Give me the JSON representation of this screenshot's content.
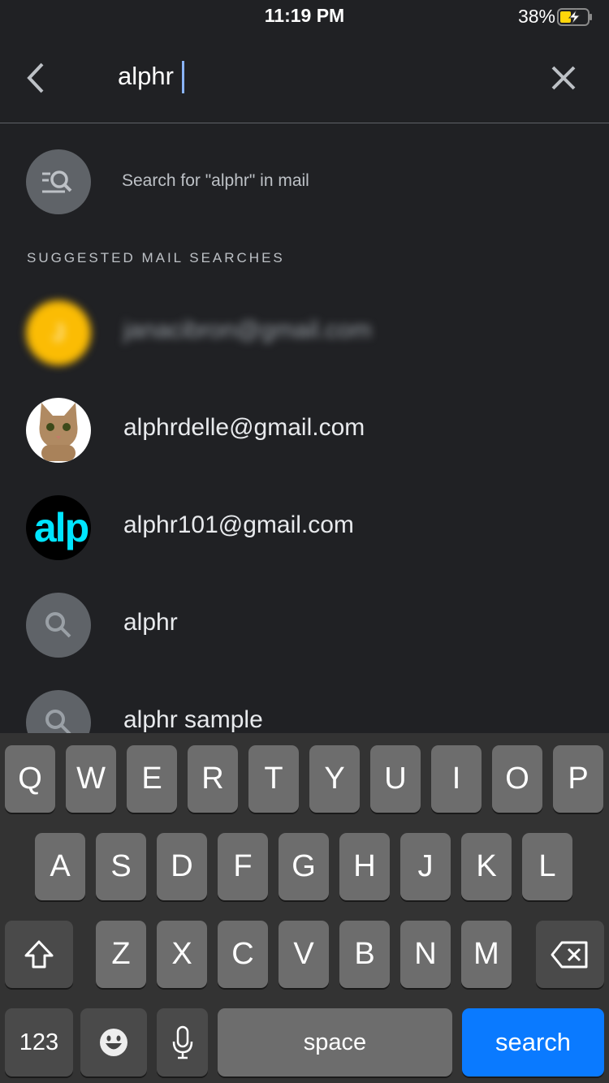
{
  "status_bar": {
    "time": "11:19 PM",
    "battery": "38%",
    "battery_level": 38,
    "charging": true
  },
  "search": {
    "query": "alphr",
    "hint": "Search for \"alphr\" in mail"
  },
  "suggestions": {
    "section_title": "SUGGESTED MAIL SEARCHES",
    "items": [
      {
        "type": "contact",
        "label": "janacibron@gmail.com",
        "avatar": "J",
        "avatar_color": "#fbbc04",
        "blurred": true
      },
      {
        "type": "contact",
        "label": "alphrdelle@gmail.com",
        "avatar": "cat-photo"
      },
      {
        "type": "contact",
        "label": "alphr101@gmail.com",
        "avatar": "alp",
        "avatar_color": "#00e5ff"
      },
      {
        "type": "query",
        "label": "alphr"
      },
      {
        "type": "query",
        "label": "alphr sample"
      }
    ]
  },
  "keyboard": {
    "row1": [
      "Q",
      "W",
      "E",
      "R",
      "T",
      "Y",
      "U",
      "I",
      "O",
      "P"
    ],
    "row2": [
      "A",
      "S",
      "D",
      "F",
      "G",
      "H",
      "J",
      "K",
      "L"
    ],
    "row3": [
      "Z",
      "X",
      "C",
      "V",
      "B",
      "N",
      "M"
    ],
    "numbers": "123",
    "space": "space",
    "action": "search",
    "action_color": "#0a7aff"
  }
}
